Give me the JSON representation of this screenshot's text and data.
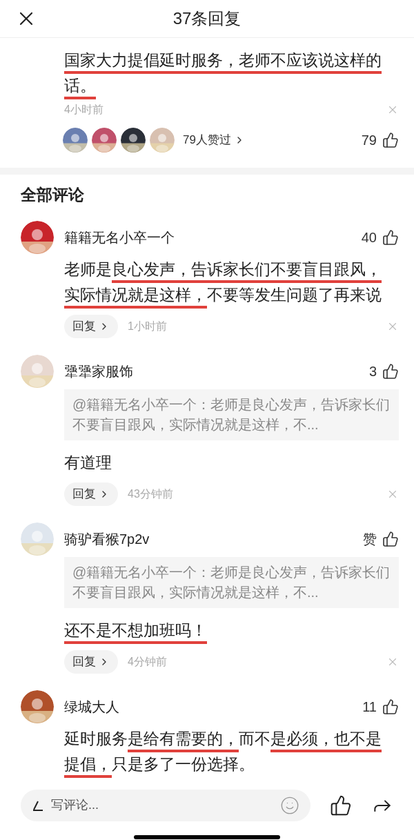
{
  "header": {
    "title": "37条回复"
  },
  "top_comment": {
    "segments": [
      {
        "text": "国家大力提倡延时服务，老师不应该说这样的话。",
        "marked": true
      }
    ],
    "time": "4小时前",
    "liked_by": "79人赞过",
    "liker_avatars": [
      {
        "kind": "picture"
      },
      {
        "kind": "picture"
      },
      {
        "kind": "picture"
      },
      {
        "kind": "picture"
      }
    ],
    "likes": "79"
  },
  "section_title": "全部评论",
  "comments": [
    {
      "name": "籍籍无名小卒一个",
      "avatar": {
        "kind": "picture"
      },
      "likes": "40",
      "segments": [
        {
          "text": "老师是",
          "marked": false
        },
        {
          "text": "良心发声，告诉家长们不要盲目跟风，实际情况就是这样，",
          "marked": true
        },
        {
          "text": "不要等发生问题了再来说",
          "marked": false
        }
      ],
      "reply": "回复",
      "time": "1小时前"
    },
    {
      "name": "犟犟家服饰",
      "avatar": {
        "kind": "picture"
      },
      "likes": "3",
      "quote": "@籍籍无名小卒一个：老师是良心发声，告诉家长们不要盲目跟风，实际情况就是这样，不...",
      "segments": [
        {
          "text": "有道理",
          "marked": false
        }
      ],
      "reply": "回复",
      "time": "43分钟前"
    },
    {
      "name": "骑驴看猴7p2v",
      "avatar": {
        "kind": "picture"
      },
      "likes": "赞",
      "quote": "@籍籍无名小卒一个：老师是良心发声，告诉家长们不要盲目跟风，实际情况就是这样，不...",
      "segments": [
        {
          "text": "还不是不想加班吗！",
          "marked": true
        }
      ],
      "reply": "回复",
      "time": "4分钟前"
    },
    {
      "name": "绿城大人",
      "avatar": {
        "kind": "picture"
      },
      "likes": "11",
      "segments": [
        {
          "text": "延时服务",
          "marked": false
        },
        {
          "text": "是给有需要的，",
          "marked": true
        },
        {
          "text": "而不",
          "marked": false
        },
        {
          "text": "是必须，也不是提倡，",
          "marked": true
        },
        {
          "text": "只是多了一份选择。",
          "marked": false
        }
      ]
    }
  ],
  "composer": {
    "placeholder": "写评论..."
  }
}
